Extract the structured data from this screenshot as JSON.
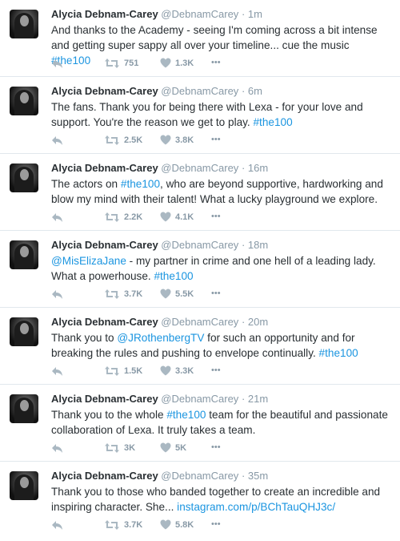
{
  "tweets": [
    {
      "name": "Alycia Debnam-Carey",
      "handle": "@DebnamCarey",
      "sep": "·",
      "time": "1m",
      "text": "And thanks to the Academy - seeing I'm coming across a bit intense and getting super sappy all over your timeline... cue the music ",
      "link": "#the100",
      "text_after": "",
      "retweets": "751",
      "likes": "1.3K",
      "more": "•••"
    },
    {
      "name": "Alycia Debnam-Carey",
      "handle": "@DebnamCarey",
      "sep": "·",
      "time": "6m",
      "text": "The fans. Thank you for being there with Lexa - for your love and support.  You're the reason we get to play. ",
      "link": "#the100",
      "text_after": "",
      "retweets": "2.5K",
      "likes": "3.8K",
      "more": "•••"
    },
    {
      "name": "Alycia Debnam-Carey",
      "handle": "@DebnamCarey",
      "sep": "·",
      "time": "16m",
      "text": "The actors on ",
      "link": "#the100",
      "text_after": ", who are beyond supportive, hardworking and blow my mind with their talent! What a lucky playground we explore.",
      "retweets": "2.2K",
      "likes": "4.1K",
      "more": "•••"
    },
    {
      "name": "Alycia Debnam-Carey",
      "handle": "@DebnamCarey",
      "sep": "·",
      "time": "18m",
      "text": "",
      "link": "@MisElizaJane",
      "text_after": " - my partner in crime and one hell of a leading lady. What a powerhouse.  ",
      "link2": "#the100",
      "retweets": "3.7K",
      "likes": "5.5K",
      "more": "•••"
    },
    {
      "name": "Alycia Debnam-Carey",
      "handle": "@DebnamCarey",
      "sep": "·",
      "time": "20m",
      "text": "Thank you to ",
      "link": "@JRothenbergTV",
      "text_after": " for such an opportunity and for breaking the rules and pushing to envelope continually. ",
      "link2": "#the100",
      "retweets": "1.5K",
      "likes": "3.3K",
      "more": "•••"
    },
    {
      "name": "Alycia Debnam-Carey",
      "handle": "@DebnamCarey",
      "sep": "·",
      "time": "21m",
      "text": "Thank you to the whole ",
      "link": "#the100",
      "text_after": " team for the beautiful and passionate collaboration of Lexa. It truly takes a team.",
      "retweets": "3K",
      "likes": "5K",
      "more": "•••"
    },
    {
      "name": "Alycia Debnam-Carey",
      "handle": "@DebnamCarey",
      "sep": "·",
      "time": "35m",
      "text": "Thank you to those who banded together to create an incredible and inspiring character. She... ",
      "link": "instagram.com/p/BChTauQHJ3c/",
      "text_after": "",
      "retweets": "3.7K",
      "likes": "5.8K",
      "more": "•••"
    }
  ]
}
